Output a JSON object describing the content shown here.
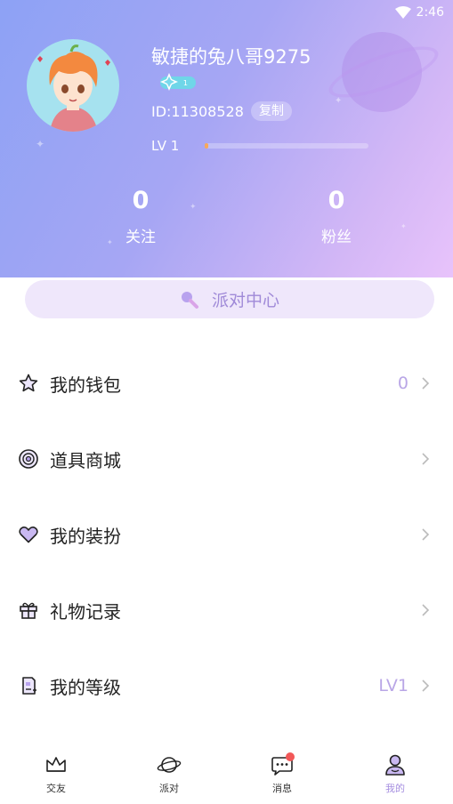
{
  "status_bar": {
    "time": "2:46"
  },
  "profile": {
    "username": "敏捷的兔八哥9275",
    "badge_level": "1",
    "id_text": "ID:11308528",
    "copy_label": "复制",
    "level_label": "LV 1",
    "level_progress": 0.02
  },
  "stats": [
    {
      "value": "0",
      "label": "关注"
    },
    {
      "value": "0",
      "label": "粉丝"
    }
  ],
  "party_center": {
    "label": "派对中心"
  },
  "menu": [
    {
      "label": "我的钱包",
      "value": "0",
      "icon": "star-icon"
    },
    {
      "label": "道具商城",
      "value": "",
      "icon": "disc-icon"
    },
    {
      "label": "我的装扮",
      "value": "",
      "icon": "heart-icon"
    },
    {
      "label": "礼物记录",
      "value": "",
      "icon": "gift-icon"
    },
    {
      "label": "我的等级",
      "value": "LV1",
      "icon": "level-icon"
    }
  ],
  "tabs": [
    {
      "label": "交友",
      "icon": "crown-icon"
    },
    {
      "label": "派对",
      "icon": "planet-icon"
    },
    {
      "label": "消息",
      "icon": "chat-icon"
    },
    {
      "label": "我的",
      "icon": "profile-icon"
    }
  ],
  "colors": {
    "accent": "#a68fe0",
    "header_gradient_start": "#8da2f5",
    "header_gradient_end": "#e8c3fb",
    "notification_dot": "#f25858"
  }
}
